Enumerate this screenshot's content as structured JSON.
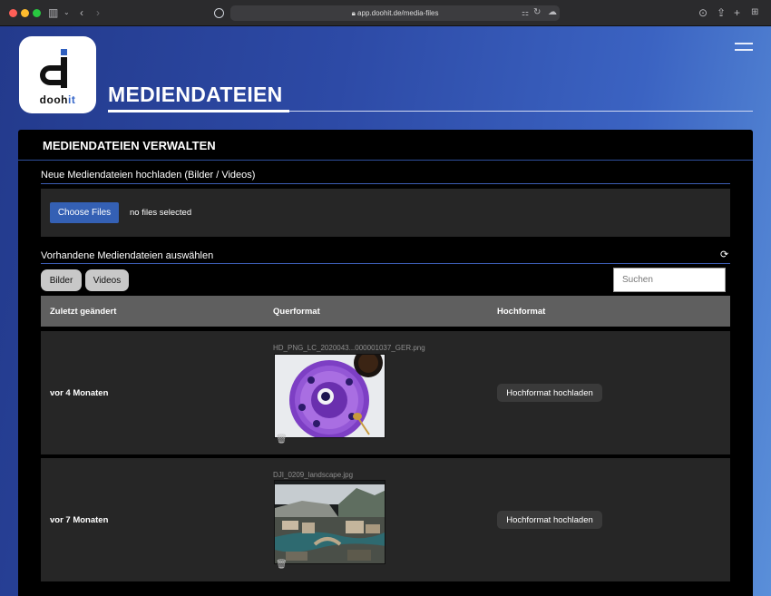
{
  "browser": {
    "url": "app.doohit.de/media-files"
  },
  "logo": {
    "text_main": "dooh",
    "text_accent": "it"
  },
  "header": {
    "title": "MEDIENDATEIEN"
  },
  "panel": {
    "title": "MEDIENDATEIEN VERWALTEN",
    "upload_section_label": "Neue Mediendateien hochladen (Bilder / Videos)",
    "choose_files_label": "Choose Files",
    "no_files_text": "no files selected",
    "existing_section_label": "Vorhandene Mediendateien auswählen",
    "filters": [
      "Bilder",
      "Videos"
    ],
    "search_placeholder": "Suchen"
  },
  "table": {
    "columns": [
      "Zuletzt geändert",
      "Querformat",
      "Hochformat"
    ],
    "rows": [
      {
        "modified": "vor 4 Monaten",
        "landscape_filename": "HD_PNG_LC_2020043...000001037_GER.png",
        "portrait_action": "Hochformat hochladen"
      },
      {
        "modified": "vor 7 Monaten",
        "landscape_filename": "DJI_0209_landscape.jpg",
        "portrait_action": "Hochformat hochladen"
      }
    ]
  },
  "colors": {
    "accent": "#3460b4",
    "panel_bg": "#000000",
    "row_bg": "#262626",
    "header_bg": "#5f5f5f"
  }
}
